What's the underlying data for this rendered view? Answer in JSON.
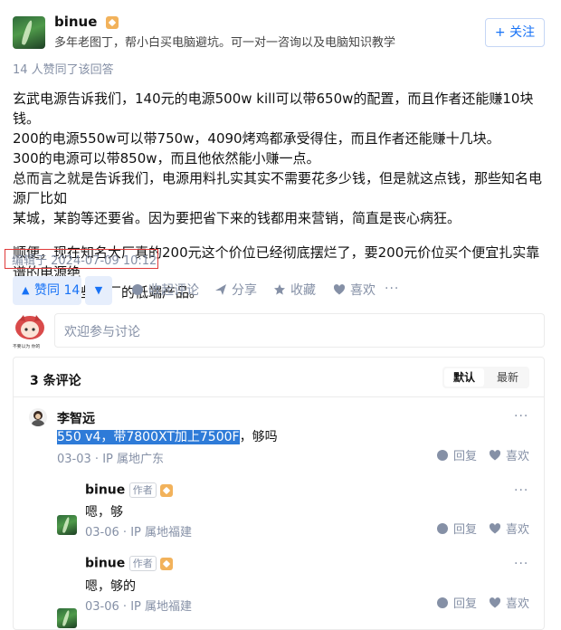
{
  "author": {
    "name": "binue",
    "bio": "多年老图丁，帮小白买电脑避坑。可一对一咨询以及电脑知识教学",
    "follow_label": "+ 关注",
    "upvote_summary": "14 人赞同了该回答"
  },
  "answer": {
    "paragraphs": [
      "玄武电源告诉我们，140元的电源500w kill可以带650w的配置，而且作者还能赚10块钱。",
      "200的电源550w可以带750w，4090烤鸡都承受得住，而且作者还能赚十几块。",
      "300的电源可以带850w，而且他依然能小赚一点。",
      "总而言之就是告诉我们，电源用料扎实其实不需要花多少钱，但是就这点钱，那些知名电源厂比如",
      "某城，某韵等还要省。因为要把省下来的钱都用来营销，简直是丧心病狂。",
      "顺便，现在知名大厂真的200元这个价位已经彻底摆烂了，要200元价位买个便宜扎实靠谱的电源绝",
      "对不能信那些大厂的低端产品。"
    ],
    "edited": "编辑于 2024-07-09 10:12"
  },
  "actions": {
    "upvote": "赞同 14",
    "downvote": "▼",
    "collapse_comments": "收起评论",
    "share": "分享",
    "favorite": "收藏",
    "like": "喜欢",
    "more": "···"
  },
  "comment_input": {
    "placeholder": "欢迎参与讨论",
    "avatar_caption": "不要以为 你的头像了"
  },
  "comments_panel": {
    "count_label": "3 条评论",
    "sort_default": "默认",
    "sort_latest": "最新"
  },
  "comments": [
    {
      "name": "李智远",
      "text_highlight": "550 v4，带7800XT加上7500F",
      "text_rest": "，够吗",
      "date": "03-03",
      "location": "IP 属地广东",
      "reply": "回复",
      "like": "喜欢"
    }
  ],
  "replies": [
    {
      "name": "binue",
      "tag": "作者",
      "text": "嗯，够",
      "date": "03-06",
      "location": "IP 属地福建",
      "reply": "回复",
      "like": "喜欢"
    },
    {
      "name": "binue",
      "tag": "作者",
      "text": "嗯，够的",
      "date": "03-06",
      "location": "IP 属地福建",
      "reply": "回复",
      "like": "喜欢"
    }
  ],
  "colors": {
    "brand": "#1772f6",
    "muted": "#8590a6",
    "highlight": "#2e7bd8",
    "edited_outline": "#e03a3a"
  }
}
